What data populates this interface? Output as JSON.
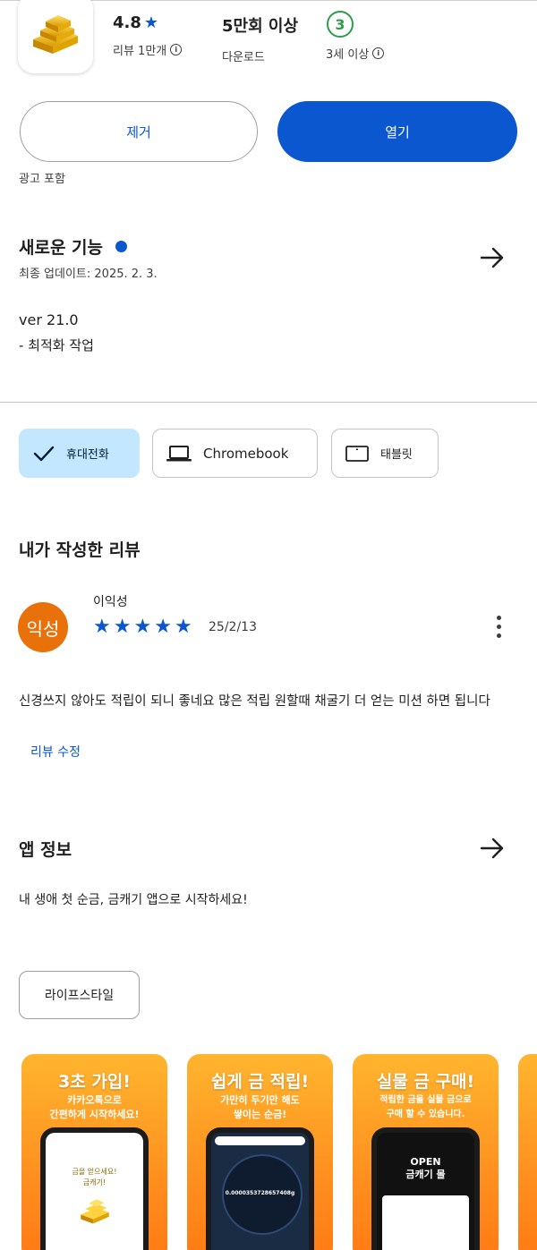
{
  "stats": {
    "rating": "4.8",
    "rating_label": "리뷰 1만개",
    "downloads": "5만회 이상",
    "downloads_label": "다운로드",
    "age_rating": "3",
    "age_label": "3세 이상"
  },
  "actions": {
    "uninstall_label": "제거",
    "open_label": "열기",
    "ads_notice": "광고 포함"
  },
  "whats_new": {
    "title": "새로운 기능",
    "last_updated": "최종 업데이트: 2025. 2. 3.",
    "version": "ver 21.0",
    "notes": "- 최적화 작업"
  },
  "devices": [
    {
      "label": "휴대전화",
      "selected": true
    },
    {
      "label": "Chromebook",
      "selected": false
    },
    {
      "label": "태블릿",
      "selected": false
    }
  ],
  "my_review": {
    "title": "내가 작성한 리뷰",
    "author": "이익성",
    "avatar_text": "익성",
    "stars": 5,
    "date": "25/2/13",
    "text": "신경쓰지 않아도 적립이 되니 좋네요 많은 적립 원할때 채굴기 더 얻는 미션 하면 됩니다",
    "edit_label": "리뷰 수정"
  },
  "app_info": {
    "title": "앱 정보",
    "description": "내 생애 첫 순금, 금캐기 앱으로 시작하세요!",
    "category": "라이프스타일"
  },
  "screenshots": [
    {
      "title": "3초 가입!",
      "subtitle": "카카오톡으로\n간편하게 시작하세요!",
      "screen_text": "금을 얻으세요!\n금캐기!"
    },
    {
      "title": "쉽게 금 적립!",
      "subtitle": "가만히 두기만 해도\n쌓이는 순금!",
      "screen_text": "0.0000353728657408g"
    },
    {
      "title": "실물 금 구매!",
      "subtitle": "적립한 금을 실물 금으로\n구매 할 수 있습니다.",
      "screen_text": "OPEN\n금캐기 몰"
    }
  ],
  "colors": {
    "accent": "#0b57d0",
    "selected_chip": "#c2e7ff",
    "avatar": "#e8710a",
    "age_badge": "#2e9d4a",
    "screenshot_bg": "#ff9a1f"
  }
}
